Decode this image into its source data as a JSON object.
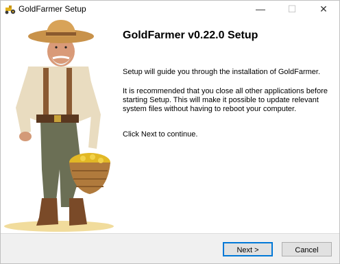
{
  "window": {
    "title": "GoldFarmer Setup",
    "controls": {
      "minimize": "—",
      "maximize": "☐",
      "close": "✕"
    },
    "app_icon": "tractor-icon"
  },
  "hero": {
    "image": "gold-farmer-illustration"
  },
  "main": {
    "heading": "GoldFarmer v0.22.0 Setup",
    "paragraph1": "Setup will guide you through the installation of GoldFarmer.",
    "paragraph2": "It is recommended that you close all other applications before starting Setup. This will make it possible to update relevant system files without having to reboot your computer.",
    "paragraph3": "Click Next to continue."
  },
  "buttons": {
    "next": "Next >",
    "cancel": "Cancel"
  },
  "colors": {
    "accent": "#0078d7",
    "gold": "#d9a520"
  }
}
